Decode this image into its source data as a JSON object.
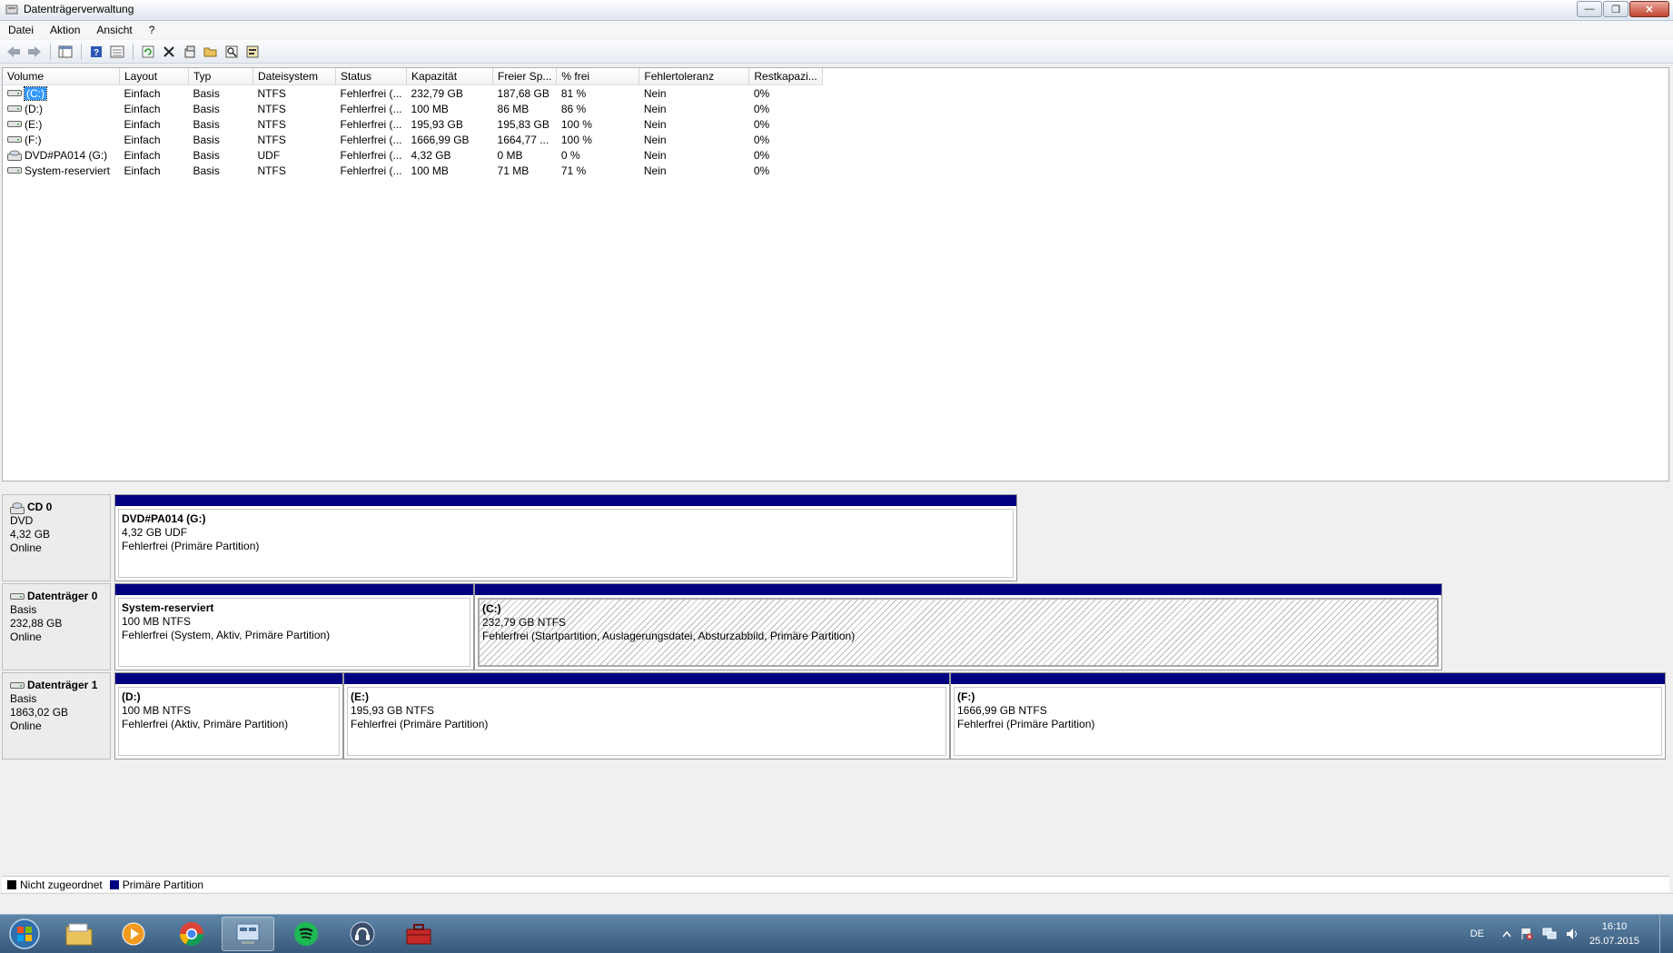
{
  "window": {
    "title": "Datenträgerverwaltung",
    "buttons": {
      "minimize": "—",
      "maximize": "❐",
      "close": "✕"
    }
  },
  "menu": [
    "Datei",
    "Aktion",
    "Ansicht",
    "?"
  ],
  "toolbar": [
    "back-icon",
    "forward-icon",
    "console-tree-icon",
    "help-icon",
    "list-view-icon",
    "refresh-icon",
    "delete-icon",
    "properties-icon",
    "open-icon",
    "explore-icon",
    "settings-icon"
  ],
  "volume_list": {
    "columns": [
      "Volume",
      "Layout",
      "Typ",
      "Dateisystem",
      "Status",
      "Kapazität",
      "Freier Sp...",
      "% frei",
      "Fehlertoleranz",
      "Restkapazi..."
    ],
    "rows": [
      {
        "volume": "(C:)",
        "icon": "drive-icon",
        "layout": "Einfach",
        "type": "Basis",
        "fs": "NTFS",
        "status": "Fehlerfrei (...",
        "capacity": "232,79 GB",
        "free": "187,68 GB",
        "pct": "81 %",
        "fault": "Nein",
        "overhead": "0%"
      },
      {
        "volume": "(D:)",
        "icon": "drive-icon",
        "layout": "Einfach",
        "type": "Basis",
        "fs": "NTFS",
        "status": "Fehlerfrei (...",
        "capacity": "100 MB",
        "free": "86 MB",
        "pct": "86 %",
        "fault": "Nein",
        "overhead": "0%"
      },
      {
        "volume": "(E:)",
        "icon": "drive-icon",
        "layout": "Einfach",
        "type": "Basis",
        "fs": "NTFS",
        "status": "Fehlerfrei (...",
        "capacity": "195,93 GB",
        "free": "195,83 GB",
        "pct": "100 %",
        "fault": "Nein",
        "overhead": "0%"
      },
      {
        "volume": "(F:)",
        "icon": "drive-icon",
        "layout": "Einfach",
        "type": "Basis",
        "fs": "NTFS",
        "status": "Fehlerfrei (...",
        "capacity": "1666,99 GB",
        "free": "1664,77 ...",
        "pct": "100 %",
        "fault": "Nein",
        "overhead": "0%"
      },
      {
        "volume": "DVD#PA014 (G:)",
        "icon": "dvd-icon",
        "layout": "Einfach",
        "type": "Basis",
        "fs": "UDF",
        "status": "Fehlerfrei (...",
        "capacity": "4,32 GB",
        "free": "0 MB",
        "pct": "0 %",
        "fault": "Nein",
        "overhead": "0%"
      },
      {
        "volume": "System-reserviert",
        "icon": "drive-icon",
        "layout": "Einfach",
        "type": "Basis",
        "fs": "NTFS",
        "status": "Fehlerfrei (...",
        "capacity": "100 MB",
        "free": "71 MB",
        "pct": "71 %",
        "fault": "Nein",
        "overhead": "0%"
      }
    ]
  },
  "disks": [
    {
      "name": "CD 0",
      "type": "DVD",
      "size": "4,32 GB",
      "state": "Online",
      "partitions": [
        {
          "name": "DVD#PA014  (G:)",
          "size": "4,32 GB UDF",
          "status": "Fehlerfrei (Primäre Partition)"
        }
      ]
    },
    {
      "name": "Datenträger 0",
      "type": "Basis",
      "size": "232,88 GB",
      "state": "Online",
      "partitions": [
        {
          "name": "System-reserviert",
          "size": "100 MB NTFS",
          "status": "Fehlerfrei (System, Aktiv, Primäre Partition)"
        },
        {
          "name": "(C:)",
          "size": "232,79 GB NTFS",
          "status": "Fehlerfrei (Startpartition, Auslagerungsdatei, Absturzabbild, Primäre Partition)"
        }
      ]
    },
    {
      "name": "Datenträger 1",
      "type": "Basis",
      "size": "1863,02 GB",
      "state": "Online",
      "partitions": [
        {
          "name": "(D:)",
          "size": "100 MB NTFS",
          "status": "Fehlerfrei (Aktiv, Primäre Partition)"
        },
        {
          "name": "(E:)",
          "size": "195,93 GB NTFS",
          "status": "Fehlerfrei (Primäre Partition)"
        },
        {
          "name": "(F:)",
          "size": "1666,99 GB NTFS",
          "status": "Fehlerfrei (Primäre Partition)"
        }
      ]
    }
  ],
  "legend": [
    {
      "label": "Nicht zugeordnet",
      "color": "#000000"
    },
    {
      "label": "Primäre Partition",
      "color": "#000080"
    }
  ],
  "taskbar": {
    "apps": [
      "explorer-icon",
      "media-player-icon",
      "chrome-icon",
      "disk-management-icon",
      "spotify-icon",
      "teamspeak-icon",
      "toolbox-icon"
    ],
    "tray": {
      "lang": "DE",
      "time": "16:10",
      "date": "25.07.2015"
    }
  }
}
